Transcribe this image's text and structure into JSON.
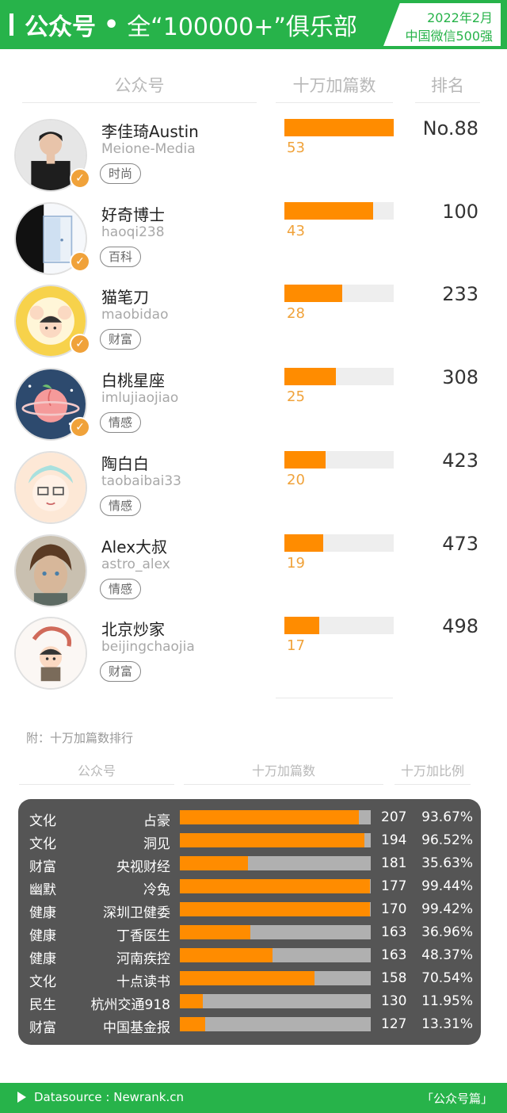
{
  "header": {
    "title_main": "公众号",
    "title_sub": "全“100000+”俱乐部",
    "badge_line1": "2022年2月",
    "badge_line2": "中国微信500强"
  },
  "table_headers": {
    "account": "公众号",
    "count": "十万加篇数",
    "rank": "排名"
  },
  "colors": {
    "brand_green": "#27b34a",
    "bar_orange": "#ff8c00",
    "count_orange": "#f0a23a",
    "panel_gray": "#555555"
  },
  "chart_data": [
    {
      "type": "bar",
      "categories": [
        "李佳琦Austin",
        "好奇博士",
        "猫笔刀",
        "白桃星座",
        "陶白白",
        "Alex大叔",
        "北京炒家"
      ],
      "values": [
        53,
        43,
        28,
        25,
        20,
        19,
        17
      ],
      "ylabel": "十万加篇数",
      "xlim": [
        0,
        53
      ]
    },
    {
      "type": "bar",
      "categories": [
        "占豪",
        "洞见",
        "央视财经",
        "冷兔",
        "深圳卫健委",
        "丁香医生",
        "河南疾控",
        "十点读书",
        "杭州交通918",
        "中国基金报"
      ],
      "series": [
        {
          "name": "十万加篇数",
          "values": [
            207,
            194,
            181,
            177,
            170,
            163,
            163,
            158,
            130,
            127
          ]
        },
        {
          "name": "十万加比例",
          "values": [
            93.67,
            96.52,
            35.63,
            99.44,
            99.42,
            36.96,
            48.37,
            70.54,
            11.95,
            13.31
          ]
        }
      ],
      "xlim": [
        0,
        100
      ]
    }
  ],
  "accounts": [
    {
      "name": "李佳琦Austin",
      "id": "Meione-Media",
      "tag": "时尚",
      "count": "53",
      "count_value": 53,
      "rank": "No.88",
      "verified": true,
      "avatar": "portrait-man-avatar"
    },
    {
      "name": "好奇博士",
      "id": "haoqi238",
      "tag": "百科",
      "count": "43",
      "count_value": 43,
      "rank": "100",
      "verified": true,
      "avatar": "door-avatar"
    },
    {
      "name": "猫笔刀",
      "id": "maobidao",
      "tag": "财富",
      "count": "28",
      "count_value": 28,
      "rank": "233",
      "verified": true,
      "avatar": "cartoon-family-avatar"
    },
    {
      "name": "白桃星座",
      "id": "imlujiaojiao",
      "tag": "情感",
      "count": "25",
      "count_value": 25,
      "rank": "308",
      "verified": true,
      "avatar": "peach-planet-avatar"
    },
    {
      "name": "陶白白",
      "id": "taobaibai33",
      "tag": "情感",
      "count": "20",
      "count_value": 20,
      "rank": "423",
      "verified": false,
      "avatar": "cartoon-boy-avatar"
    },
    {
      "name": "Alex大叔",
      "id": "astro_alex",
      "tag": "情感",
      "count": "19",
      "count_value": 19,
      "rank": "473",
      "verified": false,
      "avatar": "painted-boy-avatar"
    },
    {
      "name": "北京炒家",
      "id": "beijingchaojia",
      "tag": "财富",
      "count": "17",
      "count_value": 17,
      "rank": "498",
      "verified": false,
      "avatar": "cartoon-kid-avatar"
    }
  ],
  "appendix": {
    "note": "附：十万加篇数排行",
    "headers": {
      "account": "公众号",
      "count": "十万加篇数",
      "ratio": "十万加比例"
    },
    "rows": [
      {
        "category": "文化",
        "name": "占豪",
        "count": "207",
        "ratio": "93.67%",
        "ratio_value": 93.67
      },
      {
        "category": "文化",
        "name": "洞见",
        "count": "194",
        "ratio": "96.52%",
        "ratio_value": 96.52
      },
      {
        "category": "财富",
        "name": "央视财经",
        "count": "181",
        "ratio": "35.63%",
        "ratio_value": 35.63
      },
      {
        "category": "幽默",
        "name": "冷兔",
        "count": "177",
        "ratio": "99.44%",
        "ratio_value": 99.44
      },
      {
        "category": "健康",
        "name": "深圳卫健委",
        "count": "170",
        "ratio": "99.42%",
        "ratio_value": 99.42
      },
      {
        "category": "健康",
        "name": "丁香医生",
        "count": "163",
        "ratio": "36.96%",
        "ratio_value": 36.96
      },
      {
        "category": "健康",
        "name": "河南疾控",
        "count": "163",
        "ratio": "48.37%",
        "ratio_value": 48.37
      },
      {
        "category": "文化",
        "name": "十点读书",
        "count": "158",
        "ratio": "70.54%",
        "ratio_value": 70.54
      },
      {
        "category": "民生",
        "name": "杭州交通918",
        "count": "130",
        "ratio": "11.95%",
        "ratio_value": 11.95
      },
      {
        "category": "财富",
        "name": "中国基金报",
        "count": "127",
        "ratio": "13.31%",
        "ratio_value": 13.31
      }
    ]
  },
  "footer": {
    "source": "Datasource : Newrank.cn",
    "tag": "「公众号篇」",
    "icon": "play-triangle-icon"
  }
}
